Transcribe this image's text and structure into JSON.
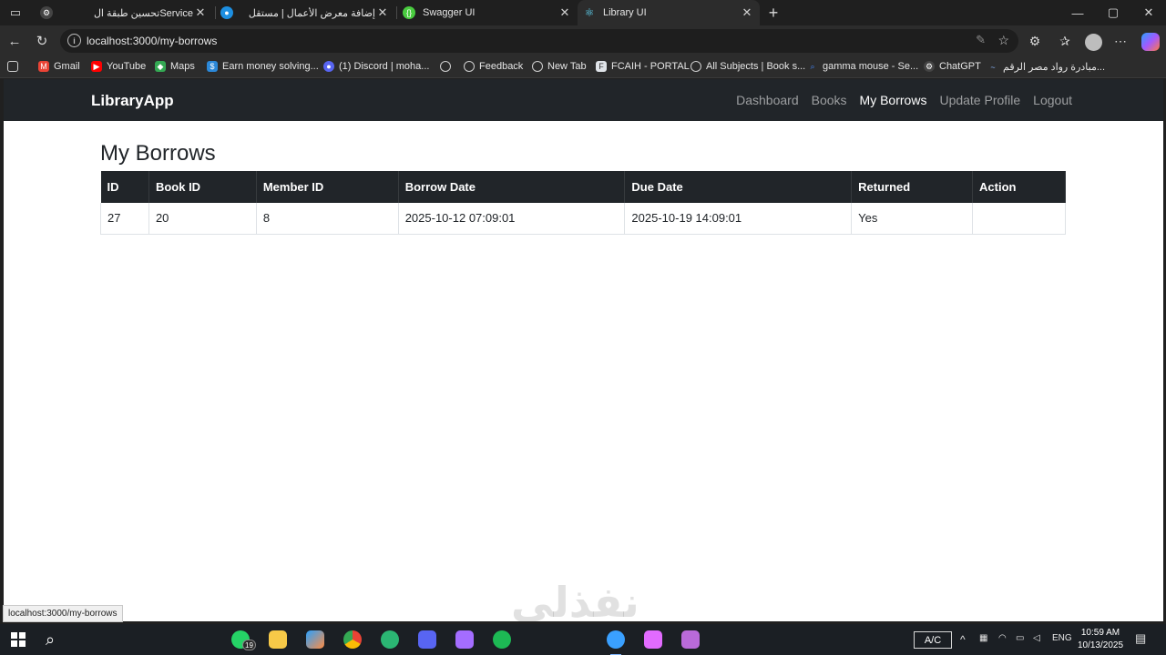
{
  "browser": {
    "tabs": [
      {
        "title": "تحسين طبقة الService",
        "favicon": "openai-icon",
        "active": false
      },
      {
        "title": "إضافة معرض الأعمال | مستقل",
        "favicon": "mostaql-icon",
        "active": false
      },
      {
        "title": "Swagger UI",
        "favicon": "swagger-icon",
        "active": false
      },
      {
        "title": "Library UI",
        "favicon": "react-icon",
        "active": true
      }
    ],
    "new_tab_label": "+",
    "url": "localhost:3000/my-borrows",
    "bookmarks": [
      {
        "label": "Gmail",
        "icon": "gmail-icon",
        "color": "#ea4335"
      },
      {
        "label": "YouTube",
        "icon": "youtube-icon",
        "color": "#ff0000"
      },
      {
        "label": "Maps",
        "icon": "maps-icon",
        "color": "#34a853"
      },
      {
        "label": "Earn money solving...",
        "icon": "earn-icon",
        "color": "#2b88d8"
      },
      {
        "label": "(1) Discord | moha...",
        "icon": "discord-icon",
        "color": "#5865f2"
      },
      {
        "label": "",
        "icon": "globe-icon",
        "color": "#9aa0a6"
      },
      {
        "label": "Feedback",
        "icon": "globe-icon",
        "color": "#9aa0a6"
      },
      {
        "label": "New Tab",
        "icon": "globe-icon",
        "color": "#9aa0a6"
      },
      {
        "label": "FCAIH - PORTAL",
        "icon": "portal-icon",
        "color": "#dfe3e8"
      },
      {
        "label": "All Subjects | Book s...",
        "icon": "globe-icon",
        "color": "#9aa0a6"
      },
      {
        "label": "gamma mouse - Se...",
        "icon": "search-icon",
        "color": "#4285f4"
      },
      {
        "label": "ChatGPT",
        "icon": "openai-icon",
        "color": "#10a37f"
      },
      {
        "label": "مبادرة رواد مصر الرقم...",
        "icon": "initiative-icon",
        "color": "#8ab4f8"
      }
    ],
    "status_url": "localhost:3000/my-borrows"
  },
  "app": {
    "brand": "LibraryApp",
    "nav": [
      {
        "label": "Dashboard",
        "active": false
      },
      {
        "label": "Books",
        "active": false
      },
      {
        "label": "My Borrows",
        "active": true
      },
      {
        "label": "Update Profile",
        "active": false
      },
      {
        "label": "Logout",
        "active": false
      }
    ],
    "page_title": "My Borrows",
    "table": {
      "columns": [
        "ID",
        "Book ID",
        "Member ID",
        "Borrow Date",
        "Due Date",
        "Returned",
        "Action"
      ],
      "rows": [
        [
          "27",
          "20",
          "8",
          "2025-10-12 07:09:01",
          "2025-10-19 14:09:01",
          "Yes",
          ""
        ]
      ]
    }
  },
  "watermark": "نفذلي",
  "taskbar": {
    "whatsapp_badge": "19",
    "keyboard_mode": "A/C",
    "language": "ENG",
    "time": "10:59 AM",
    "date": "10/13/2025",
    "app_colors": [
      "#25d366",
      "#f7c948",
      "#ff8c42",
      "#4285f4",
      "#2bb673",
      "#5865f2",
      "#a46dff",
      "#1db954",
      "#3aa0ff",
      "#e26bff",
      "#b96ad9"
    ]
  }
}
